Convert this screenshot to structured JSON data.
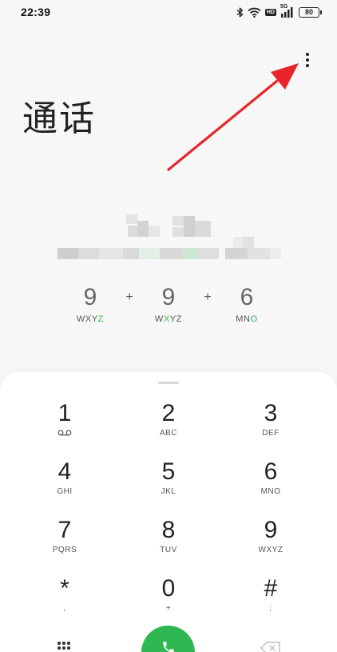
{
  "status_bar": {
    "time": "22:39",
    "battery": "80",
    "network_badge": "HD",
    "signal_label": "5G"
  },
  "header": {
    "title": "通话"
  },
  "dialed_number": {
    "digits": [
      {
        "digit": "9",
        "letters_pre": "WXY",
        "letters_hl": "Z",
        "letters_post": ""
      },
      {
        "digit": "9",
        "letters_pre": "W",
        "letters_hl": "X",
        "letters_post": "YZ"
      },
      {
        "digit": "6",
        "letters_pre": "MN",
        "letters_hl": "O",
        "letters_post": ""
      }
    ],
    "separator": "+",
    "highlight_color": "#2fb851"
  },
  "keypad": {
    "keys": [
      {
        "digit": "1",
        "letters": ""
      },
      {
        "digit": "2",
        "letters": "ABC"
      },
      {
        "digit": "3",
        "letters": "DEF"
      },
      {
        "digit": "4",
        "letters": "GHI"
      },
      {
        "digit": "5",
        "letters": "JKL"
      },
      {
        "digit": "6",
        "letters": "MNO"
      },
      {
        "digit": "7",
        "letters": "PQRS"
      },
      {
        "digit": "8",
        "letters": "TUV"
      },
      {
        "digit": "9",
        "letters": "WXYZ"
      },
      {
        "digit": "*",
        "letters": ","
      },
      {
        "digit": "0",
        "letters": "+"
      },
      {
        "digit": "#",
        "letters": ";"
      }
    ],
    "call_button_color": "#2fb851"
  },
  "icons": {
    "more": "more-vertical-icon",
    "voicemail": "voicemail-icon",
    "call": "phone-icon",
    "backspace": "backspace-icon",
    "keypad_toggle": "dialpad-icon"
  },
  "annotation": {
    "arrow_color": "#e8252b"
  }
}
